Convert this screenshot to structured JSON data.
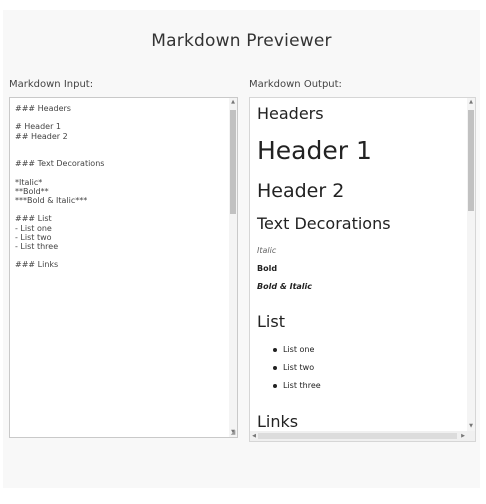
{
  "page": {
    "title": "Markdown Previewer"
  },
  "input": {
    "label": "Markdown Input:",
    "value": "### Headers\n\n# Header 1\n## Header 2\n\n\n### Text Decorations\n\n*Italic*\n**Bold**\n***Bold & Italic***\n\n### List\n- List one\n- List two\n- List three\n\n### Links"
  },
  "output": {
    "label": "Markdown Output:",
    "headers_heading": "Headers",
    "header1": "Header 1",
    "header2": "Header 2",
    "text_decorations_heading": "Text Decorations",
    "italic": "Italic",
    "bold": "Bold",
    "bold_italic": "Bold & Italic",
    "list_heading": "List",
    "list_items": [
      "List one",
      "List two",
      "List three"
    ],
    "links_heading": "Links"
  },
  "scrollbar": {
    "up_arrow": "▲",
    "down_arrow": "▼",
    "left_arrow": "◀",
    "right_arrow": "▶"
  },
  "colors": {
    "app_background": "#f8f8f8",
    "panel_background": "#ffffff",
    "text": "#333333"
  }
}
